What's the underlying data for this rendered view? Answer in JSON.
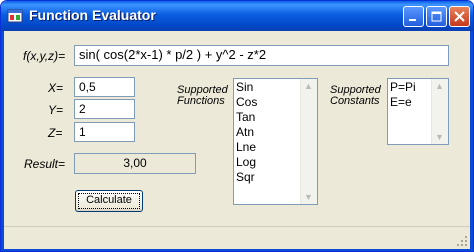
{
  "window": {
    "title": "Function Evaluator",
    "controls": [
      "minimize",
      "maximize",
      "close"
    ]
  },
  "form": {
    "function_label": "f(x,y,z)=",
    "function_value": "sin( cos(2*x-1) * p/2 ) + y^2 - z*2",
    "x_label": "X=",
    "x_value": "0,5",
    "y_label": "Y=",
    "y_value": "2",
    "z_label": "Z=",
    "z_value": "1",
    "result_label": "Result=",
    "result_value": "3,00",
    "calculate_label": "Calculate"
  },
  "functions": {
    "label_line1": "Supported",
    "label_line2": "Functions",
    "items": [
      "Sin",
      "Cos",
      "Tan",
      "Atn",
      "Lne",
      "Log",
      "Sqr"
    ]
  },
  "constants": {
    "label_line1": "Supported",
    "label_line2": "Constants",
    "items": [
      "P=Pi",
      "E=e"
    ]
  },
  "colors": {
    "titlebar": "#0b5ee0",
    "window_bg": "#ece9d8",
    "input_border": "#7f9db9"
  }
}
